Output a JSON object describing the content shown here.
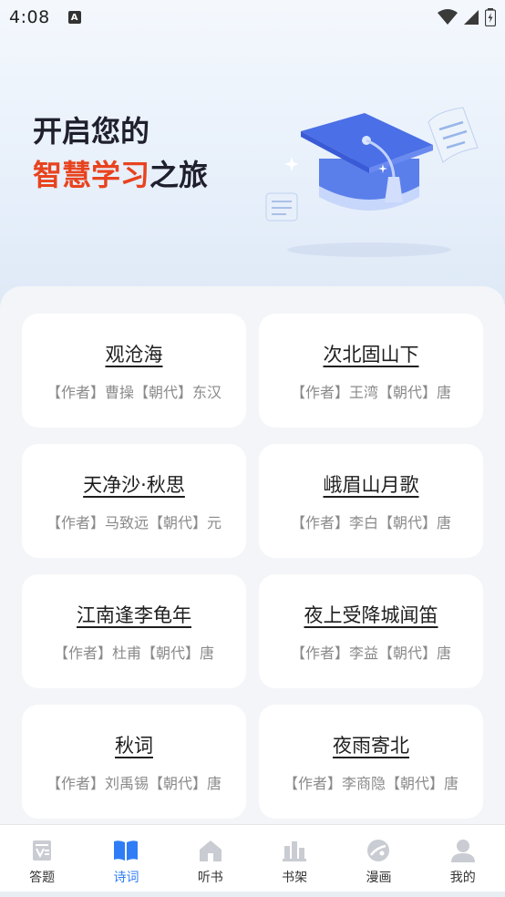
{
  "status_bar": {
    "time": "4:08",
    "notification_badge": "A"
  },
  "hero": {
    "line1": "开启您的",
    "line2_accent": "智慧学习",
    "line2_rest": "之旅",
    "accent_color": "#e8431f",
    "illustration": "graduation-cap-icon"
  },
  "poems": [
    {
      "title": "观沧海",
      "meta": "【作者】曹操【朝代】东汉"
    },
    {
      "title": "次北固山下",
      "meta": "【作者】王湾【朝代】唐"
    },
    {
      "title": "天净沙·秋思",
      "meta": "【作者】马致远【朝代】元"
    },
    {
      "title": "峨眉山月歌",
      "meta": "【作者】李白【朝代】唐"
    },
    {
      "title": "江南逢李龟年",
      "meta": "【作者】杜甫【朝代】唐"
    },
    {
      "title": "夜上受降城闻笛",
      "meta": "【作者】李益【朝代】唐"
    },
    {
      "title": "秋词",
      "meta": "【作者】刘禹锡【朝代】唐"
    },
    {
      "title": "夜雨寄北",
      "meta": "【作者】李商隐【朝代】唐"
    }
  ],
  "tabs": [
    {
      "label": "答题",
      "icon": "quiz-icon",
      "active": false
    },
    {
      "label": "诗词",
      "icon": "book-open-icon",
      "active": true
    },
    {
      "label": "听书",
      "icon": "home-icon",
      "active": false
    },
    {
      "label": "书架",
      "icon": "bookshelf-icon",
      "active": false
    },
    {
      "label": "漫画",
      "icon": "comic-icon",
      "active": false
    },
    {
      "label": "我的",
      "icon": "profile-icon",
      "active": false
    }
  ],
  "colors": {
    "active_tab": "#2f7df6",
    "inactive_icon": "#c9ccd2"
  }
}
